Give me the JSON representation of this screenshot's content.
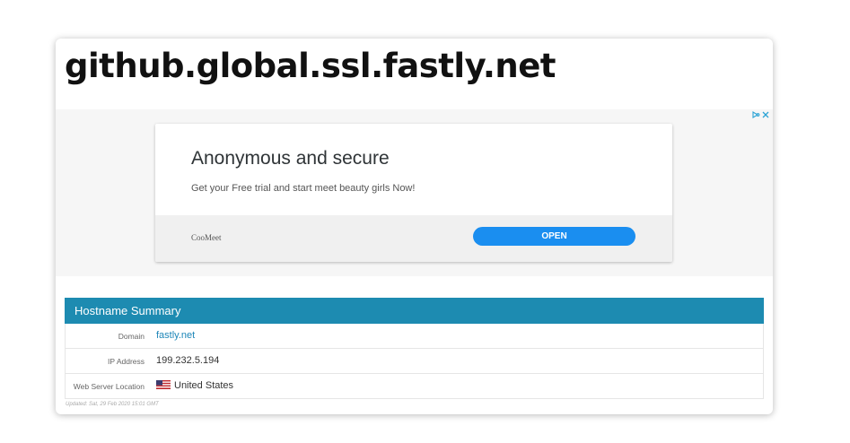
{
  "page": {
    "title": "github.global.ssl.fastly.net"
  },
  "ad": {
    "headline": "Anonymous and secure",
    "body": "Get your Free trial and start meet beauty girls Now!",
    "brand": "CooMeet",
    "cta_label": "OPEN",
    "choices_icons": [
      "adchoices-icon",
      "close-icon"
    ],
    "accent_color": "#1a8ef0"
  },
  "summary": {
    "header": "Hostname Summary",
    "header_color": "#1d8bb1",
    "rows": [
      {
        "label": "Domain",
        "value": "fastly.net"
      },
      {
        "label": "IP Address",
        "value": "199.232.5.194"
      },
      {
        "label": "Web Server Location",
        "value": "United States",
        "icon": "us-flag-icon"
      }
    ],
    "updated": "Updated: Sat, 29 Feb 2020 15:01 GMT"
  }
}
